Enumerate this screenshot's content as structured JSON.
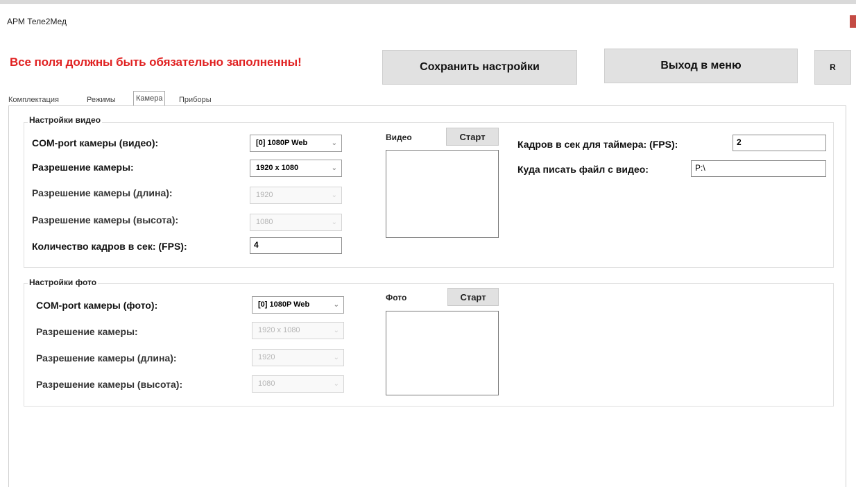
{
  "window": {
    "title": "АРМ Теле2Мед"
  },
  "header": {
    "warning": "Все поля должны быть обязательно заполненны!",
    "save_button": "Сохранить настройки",
    "exit_button": "Выход в меню",
    "r_button": "R"
  },
  "tabs": [
    {
      "label": "Комплектация",
      "active": false
    },
    {
      "label": "Режимы",
      "active": false
    },
    {
      "label": "Камера",
      "active": true
    },
    {
      "label": "Приборы",
      "active": false
    }
  ],
  "video": {
    "legend": "Настройки видео",
    "com_port_label": "COM-port камеры (видео):",
    "com_port_value": "[0] 1080P Web",
    "resolution_label": "Разрешение камеры:",
    "resolution_value": "1920 x 1080",
    "length_label": "Разрешение камеры (длина):",
    "length_value": "1920",
    "height_label": "Разрешение камеры (высота):",
    "height_value": "1080",
    "fps_label": "Количество кадров в сек: (FPS):",
    "fps_value": "4",
    "preview_label": "Видео",
    "start_button": "Старт",
    "timer_fps_label": "Кадров в сек для таймера: (FPS):",
    "timer_fps_value": "2",
    "file_path_label": "Куда писать файл с видео:",
    "file_path_value": "P:\\"
  },
  "photo": {
    "legend": "Настройки фото",
    "com_port_label": "COM-port камеры (фото):",
    "com_port_value": "[0] 1080P Web",
    "resolution_label": "Разрешение камеры:",
    "resolution_value": "1920 x 1080",
    "length_label": "Разрешение камеры (длина):",
    "length_value": "1920",
    "height_label": "Разрешение камеры (высота):",
    "height_value": "1080",
    "preview_label": "Фото",
    "start_button": "Старт"
  },
  "icons": {
    "dropdown": "chevron-down-icon",
    "close": "close-icon"
  },
  "colors": {
    "warning": "#e02020",
    "button_bg": "#e1e1e1",
    "close": "#c44b44"
  }
}
